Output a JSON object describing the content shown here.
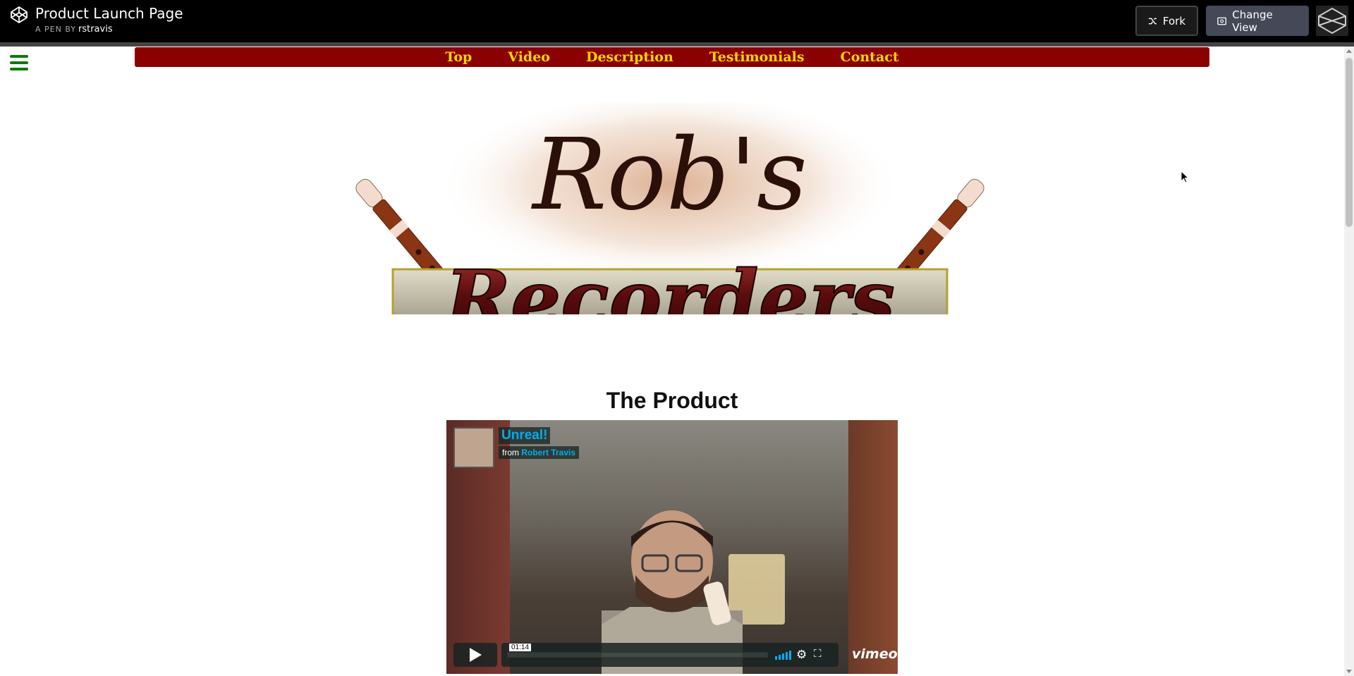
{
  "codepen": {
    "title": "Product Launch Page",
    "byline": "A PEN BY",
    "author": "rstravis",
    "fork_label": "Fork",
    "change_view_label": "Change View"
  },
  "nav": {
    "items": [
      {
        "label": "Top"
      },
      {
        "label": "Video"
      },
      {
        "label": "Description"
      },
      {
        "label": "Testimonials"
      },
      {
        "label": "Contact"
      }
    ],
    "bar_color": "#8b0000",
    "text_color": "#ffd700"
  },
  "logo": {
    "line1": "Rob's",
    "line2": "Recorders"
  },
  "product": {
    "heading": "The Product"
  },
  "video": {
    "title": "Unreal!",
    "from_prefix": "from",
    "author": "Robert Travis",
    "time": "01:14",
    "brand": "vimeo",
    "accent": "#00adef"
  },
  "icons": [
    "codepen-logo-icon",
    "fork-icon",
    "change-view-icon",
    "hamburger-menu-icon",
    "play-icon",
    "volume-icon",
    "settings-gear-icon",
    "fullscreen-icon"
  ]
}
